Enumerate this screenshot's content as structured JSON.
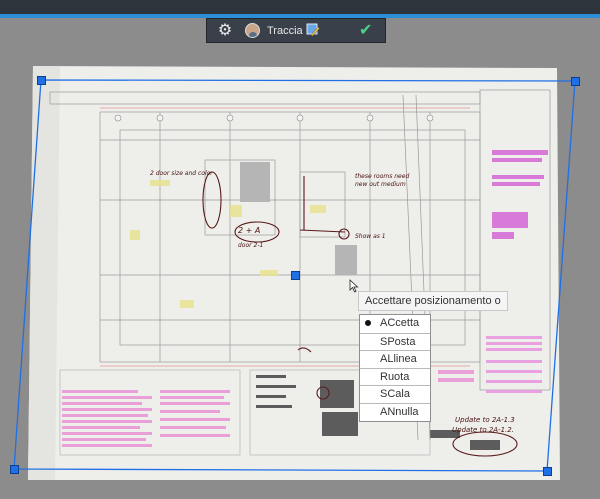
{
  "toolbar": {
    "user_name": "Traccia",
    "icons": [
      "gear-icon",
      "avatar",
      "edit-icon",
      "checkmark-icon"
    ],
    "accent_color": "#2d8fd6"
  },
  "tooltip": {
    "text": "Accettare posizionamento o"
  },
  "context_menu": {
    "selected": "ACcetta",
    "items": [
      "ACcetta",
      "SPosta",
      "ALlinea",
      "Ruota",
      "SCala",
      "ANnulla"
    ]
  },
  "drawing": {
    "annotations": [
      "2 door size and color",
      "these rooms need new out medium",
      "door 2-1",
      "Show as 1",
      "2 + A",
      "Update to 2A-1.3",
      "Update to 2A-1.2."
    ]
  }
}
